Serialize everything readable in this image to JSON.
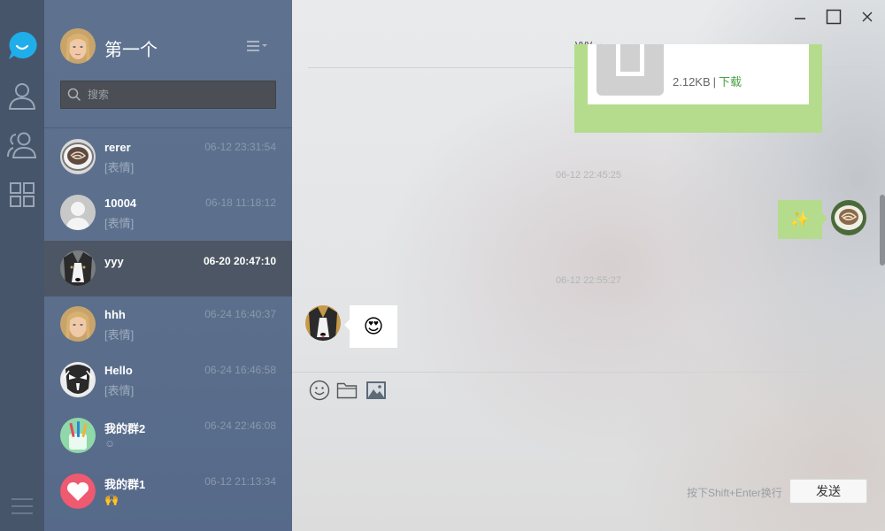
{
  "rail": {
    "items": [
      {
        "icon": "chat-bubble-icon",
        "active": true
      },
      {
        "icon": "contact-icon"
      },
      {
        "icon": "group-icon"
      },
      {
        "icon": "apps-grid-icon"
      }
    ],
    "bottom_icon": "hamburger-menu-icon",
    "accent": "#1faeea"
  },
  "me": {
    "name": "第一个",
    "avatar": "blonde-woman-avatar"
  },
  "search": {
    "placeholder": "搜索"
  },
  "conversations": [
    {
      "name": "rerer",
      "time": "06-12 23:31:54",
      "preview": "[表情]",
      "avatar": "coffee-avatar"
    },
    {
      "name": "10004",
      "time": "06-18 11:18:12",
      "preview": "[表情]",
      "avatar": "default-avatar"
    },
    {
      "name": "yyy",
      "time": "06-20 20:47:10",
      "preview": "",
      "avatar": "dog-avatar",
      "active": true
    },
    {
      "name": "hhh",
      "time": "06-24 16:40:37",
      "preview": "[表情]",
      "avatar": "blonde-woman-avatar"
    },
    {
      "name": "Hello",
      "time": "06-24 16:46:58",
      "preview": "[表情]",
      "avatar": "mask-avatar"
    },
    {
      "name": "我的群2",
      "time": "06-24 22:46:08",
      "preview": "☺",
      "avatar": "toothbrush-avatar"
    },
    {
      "name": "我的群1",
      "time": "06-12 21:13:34",
      "preview": "🙌",
      "avatar": "heart-avatar"
    }
  ],
  "chat": {
    "title": "yyy",
    "file": {
      "size": "2.12KB",
      "separator": "|",
      "download": "下载"
    },
    "timestamps": [
      "06-12 22:45:25",
      "06-12 22:55:27"
    ],
    "sent_emoji": "✨",
    "received_emoji": "😍",
    "toolbar": [
      "emoji-icon",
      "folder-icon",
      "image-icon"
    ],
    "hint": "按下Shift+Enter换行",
    "send_label": "发送",
    "colors": {
      "self_bubble": "#b4dc8c",
      "other_bubble": "#ffffff",
      "download_link": "#4aa043"
    }
  }
}
